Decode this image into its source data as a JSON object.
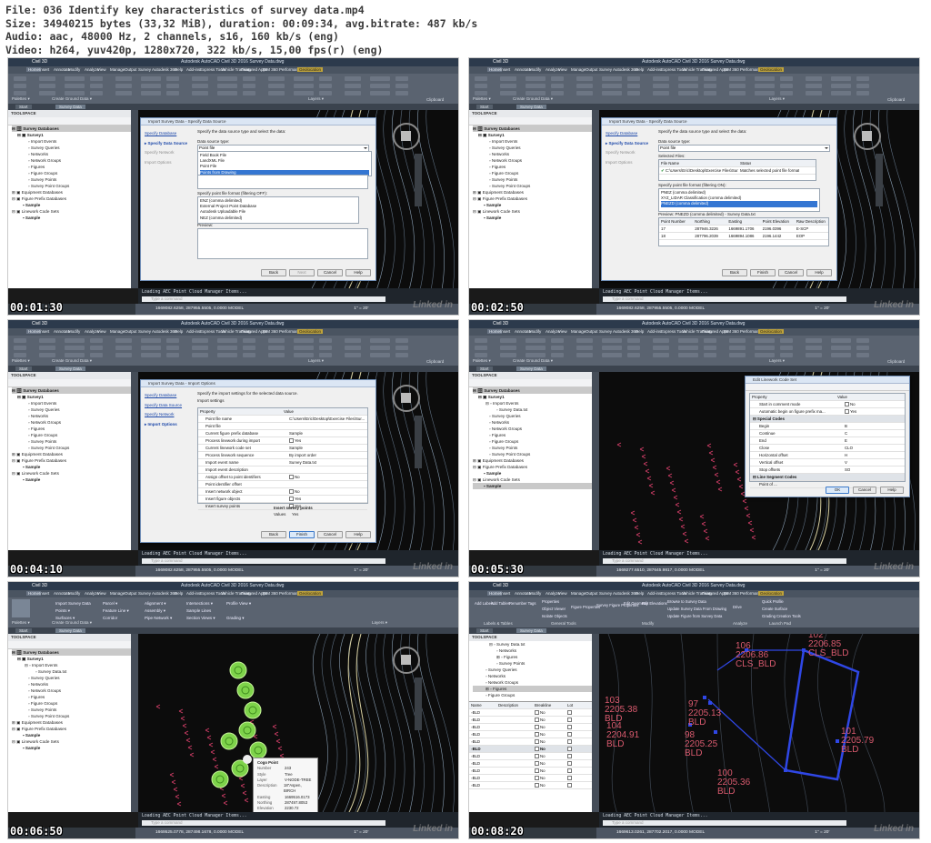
{
  "header": {
    "line1": "File: 036 Identify key characteristics of survey data.mp4",
    "line2": "Size: 34940215 bytes (33,32 MiB), duration: 00:09:34, avg.bitrate: 487 kb/s",
    "line3": "Audio: aac, 48000 Hz, 2 channels, s16, 160 kb/s (eng)",
    "line4": "Video: h264, yuv420p, 1280x720, 322 kb/s, 15,00 fps(r) (eng)"
  },
  "app": {
    "name": "Civil 3D",
    "window_title": "Autodesk AutoCAD Civil 3D 2016   Survey Data.dwg",
    "ribbon_tabs": [
      "Home",
      "Insert",
      "Annotate",
      "Modify",
      "Analyze",
      "View",
      "Manage",
      "Output",
      "Survey",
      "Autodesk 360",
      "Help",
      "Add-ins",
      "Express Tools",
      "Vehicle Tracking",
      "Featured Apps",
      "BIM 360",
      "Performance",
      "Geolocation"
    ],
    "ribbon_groups": [
      "Palettes ▾",
      "Create Ground Data ▾",
      "Layers ▾",
      "Clipboard"
    ],
    "file_tabs": [
      "Start",
      "Survey Data"
    ],
    "toolspace_title": "TOOLSPACE",
    "sidebar_tabs": [
      "Prospector",
      "Settings",
      "Survey",
      "Toolbox"
    ],
    "cmd_line": "Loading AEC Point Cloud Manager Items...",
    "cmd_placeholder": "Type a command",
    "status_coords": [
      "1669082.6258, 287955.5505, 0.0000",
      "1669082.6258, 287955.5505, 0.0000",
      "1669082.6258, 287955.5505, 0.0000",
      "1669277.6510, 287645.9817, 0.0000",
      "1669525.0778, 287498.1678, 0.0000",
      "1669613.0261, 287702.2017, 0.0000"
    ],
    "model": "MODEL",
    "scale": "1\" = 20'",
    "watermark": "Linked in"
  },
  "tree": {
    "root": "Survey Databases",
    "survey1": "Survey1",
    "items": [
      "Import Events",
      "Survey Queries",
      "Networks",
      "Network Groups",
      "Figures",
      "Figure Groups",
      "Survey Points",
      "Survey Point Groups"
    ],
    "equipment": "Equipment Databases",
    "figprefix": "Figure Prefix Databases",
    "sample": "Sample",
    "linework": "Linework Code Sets",
    "sample2": "Sample",
    "import_child": "Survey Data.txt"
  },
  "frames": [
    {
      "time": "00:01:30"
    },
    {
      "time": "00:02:50"
    },
    {
      "time": "00:04:10"
    },
    {
      "time": "00:05:30"
    },
    {
      "time": "00:06:50"
    },
    {
      "time": "00:08:20"
    }
  ],
  "dialog_import": {
    "title": "Import Survey Data - Specify Data Source",
    "title2": "Import Survey Data - Import Options",
    "steps": [
      "Specify Database",
      "Specify Data Source",
      "Specify Network",
      "Import Options"
    ],
    "intro": "Specify the data source type and select the data:",
    "intro2": "Specify the import settings for the selected data source.",
    "data_source_type": "Data source type:",
    "selected": "Point file",
    "options": [
      "Field Book File",
      "LandXML File",
      "Point File",
      "Points from Drawing"
    ],
    "selected_files": "Selected Files:",
    "col_file": "File Name",
    "col_status": "Status",
    "file_path": "C:\\Users\\Eric\\Desktop\\Exercise Files\\Sur...",
    "file_status": "Matches selected point file format",
    "format_label": "Specify point file format (filtering OFF):",
    "format_label_on": "Specify point file format (filtering ON):",
    "formats": [
      "ENZ (comma delimited)",
      "External Project Point Database",
      "Autodesk Uploadable File",
      "NEZ (comma delimited)"
    ],
    "formats_on": [
      "PNEZ (comma delimited)",
      "XYZ_LIDAR Classification (comma delimited)",
      "PNEZD (comma delimited)"
    ],
    "preview": "Preview:",
    "preview_on": "Preview: PNEZD (comma delimited) - Survey Data.txt",
    "preview_cols": [
      "Point Number",
      "Northing",
      "Easting",
      "Point Elevation",
      "Raw Description"
    ],
    "preview_rows": [
      [
        "17",
        "287946.3226",
        "1669891.1706",
        "2196.0396",
        "E-SCP"
      ],
      [
        "18",
        "287796.2039",
        "1669894.1086",
        "2196.1442",
        "EOP"
      ]
    ],
    "import_settings": "Import settings",
    "prop_header": [
      "Property",
      "Value"
    ],
    "props": [
      [
        "Point file name",
        "C:\\Users\\Eric\\Desktop\\Exercise Files\\Sur..."
      ],
      [
        "Point file",
        ""
      ],
      [
        "Current figure prefix database",
        "Sample"
      ],
      [
        "Process linework during import",
        "Yes"
      ],
      [
        "Current linework code set",
        "Sample"
      ],
      [
        "Process linework sequence",
        "By import order"
      ],
      [
        "Import event name",
        "Survey Data.txt"
      ],
      [
        "Import event description",
        ""
      ],
      [
        "Assign offset to point identifiers",
        "No"
      ],
      [
        "Point identifier offset",
        ""
      ],
      [
        "Insert network object",
        "No"
      ],
      [
        "Insert figure objects",
        "Yes"
      ],
      [
        "Insert survey points",
        "Yes"
      ]
    ],
    "insert_points": "Insert survey points",
    "values_label": "Values",
    "values_value": "Yes",
    "buttons": [
      "Back",
      "Next",
      "Cancel",
      "Help"
    ],
    "buttons2": [
      "Back",
      "Finish",
      "Cancel",
      "Help"
    ]
  },
  "dialog_linework": {
    "title": "Edit Linework Code Set",
    "head": [
      "Property",
      "Value"
    ],
    "rows": [
      [
        "Start in comment mode",
        "No",
        false
      ],
      [
        "Automatic begin on figure prefix ma...",
        "Yes",
        false
      ],
      [
        "Special Codes",
        "",
        true
      ],
      [
        "Begin",
        "B",
        false
      ],
      [
        "Continue",
        "C",
        false
      ],
      [
        "End",
        "E",
        false
      ],
      [
        "Close",
        "CLO",
        false
      ],
      [
        "Horizontal offset",
        "H",
        false
      ],
      [
        "Vertical offset",
        "V",
        false
      ],
      [
        "Stop offsets",
        "SO",
        false
      ],
      [
        "Line Segment Codes",
        "",
        true
      ],
      [
        "Point of ...",
        "",
        false
      ]
    ],
    "buttons": [
      "OK",
      "Cancel",
      "Help"
    ]
  },
  "frame5": {
    "ribbon": [
      "Import Survey Data",
      "Parcel ▾",
      "Alignment ▾",
      "Intersections ▾",
      "Profile View ▾",
      "Points ▾",
      "Feature Line ▾",
      "Assembly ▾",
      "Sample Lines",
      "Surfaces ▾",
      "Corridor",
      "Pipe Network ▾",
      "Section Views ▾",
      "Grading ▾"
    ],
    "tooltip_title": "Cogo Point",
    "tooltip": [
      [
        "Number",
        "243"
      ],
      [
        "Style",
        "Tree"
      ],
      [
        "Layer",
        "V-NODE-TREE"
      ],
      [
        "Description",
        "18\"Aspen, BIRCH"
      ],
      [
        "Easting",
        "1669516.0173"
      ],
      [
        "Northing",
        "287497.8053"
      ],
      [
        "Elevation",
        "2230.72"
      ],
      [
        "Grid Easting",
        "1669516.0173"
      ],
      [
        "Grid Northing",
        "287497.8053"
      ]
    ]
  },
  "frame6": {
    "ribbon": [
      "Add Labels",
      "Add Tables",
      "Renumber Tags",
      "Properties",
      "Object Viewer",
      "Isolate Objects",
      "Figure Properties",
      "Survey Figure Properties",
      "Edit Geometry",
      "Edit Elevations",
      "Browse to Survey Data",
      "Update Survey Data From Drawing",
      "Update Figure from Survey Data",
      "Drive",
      "Quick Profile",
      "Create Surface",
      "Grading Creation Tools"
    ],
    "groups": [
      "Labels & Tables",
      "General Tools",
      "Modify",
      "Analyze",
      "Launch Pad"
    ],
    "list_head": [
      "Name",
      "Description",
      "Breakline",
      "Lot"
    ],
    "list_rows": [
      "BLD",
      "BLD",
      "BLD",
      "BLD",
      "BLD",
      "BLD",
      "BLD",
      "BLD",
      "BLD",
      "BLD",
      "BLD"
    ],
    "no": "No",
    "labels": [
      [
        "106",
        "2206.86",
        "CLS_BLD"
      ],
      [
        "102",
        "2206.85",
        "CLS_BLD"
      ],
      [
        "103",
        "2205.38",
        "BLD"
      ],
      [
        "97",
        "2205.13",
        "BLD"
      ],
      [
        "104",
        "2204.91",
        "BLD"
      ],
      [
        "98",
        "2205.25",
        "BLD"
      ],
      [
        "101",
        "2205.79",
        "BLD"
      ],
      [
        "100",
        "2205.36",
        "BLD"
      ]
    ]
  }
}
